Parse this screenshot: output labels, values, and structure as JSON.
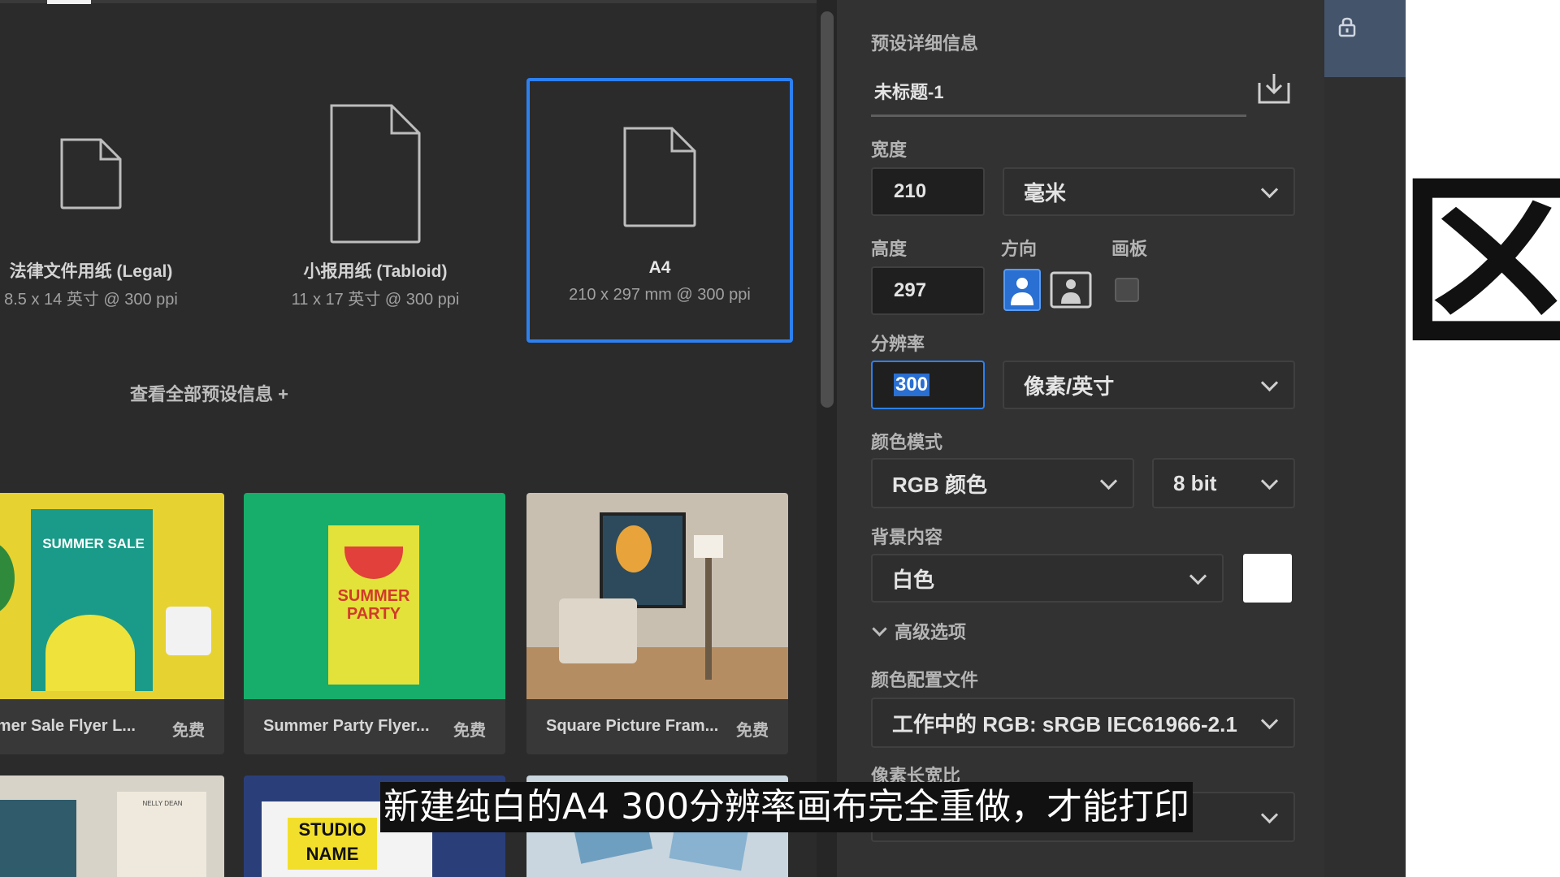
{
  "presets": [
    {
      "name": "法律文件用纸 (Legal)",
      "spec": "8.5 x 14 英寸 @ 300 ppi"
    },
    {
      "name": "小报用纸 (Tabloid)",
      "spec": "11 x 17 英寸 @ 300 ppi"
    },
    {
      "name": "A4",
      "spec": "210 x 297 mm @ 300 ppi"
    }
  ],
  "view_all": "查看全部预设信息 +",
  "templates": [
    {
      "name": "mmer Sale Flyer L...",
      "badge": "免费",
      "art": "SUMMER SALE"
    },
    {
      "name": "Summer Party Flyer...",
      "badge": "免费",
      "art": "SUMMER PARTY"
    },
    {
      "name": "Square Picture Fram...",
      "badge": "免费",
      "art": ""
    }
  ],
  "bottom_templates": [
    {
      "art": "NELLY DEAN"
    },
    {
      "art": "STUDIO NAME"
    },
    {
      "art": ""
    }
  ],
  "details": {
    "section_title": "预设详细信息",
    "doc_name": "未标题-1",
    "width_label": "宽度",
    "width_value": "210",
    "width_unit": "毫米",
    "height_label": "高度",
    "height_value": "297",
    "orientation_label": "方向",
    "artboard_label": "画板",
    "resolution_label": "分辨率",
    "resolution_value": "300",
    "resolution_unit": "像素/英寸",
    "color_mode_label": "颜色模式",
    "color_mode": "RGB 颜色",
    "bit_depth": "8 bit",
    "background_label": "背景内容",
    "background_value": "白色",
    "advanced_label": "高级选项",
    "profile_label": "颜色配置文件",
    "profile_value": "工作中的 RGB: sRGB IEC61966-2.1",
    "pixel_ratio_label": "像素长宽比"
  },
  "canvas_glyph": "区",
  "subtitle": "新建纯白的A4 300分辨率画布完全重做，才能打印",
  "colors": {
    "accent": "#2d80f0",
    "panel": "#323232",
    "field": "#1f1f1f"
  },
  "icons": [
    "document-icon",
    "save-preset-icon",
    "lock-icon",
    "portrait-icon",
    "landscape-icon",
    "chevron-down-icon"
  ]
}
